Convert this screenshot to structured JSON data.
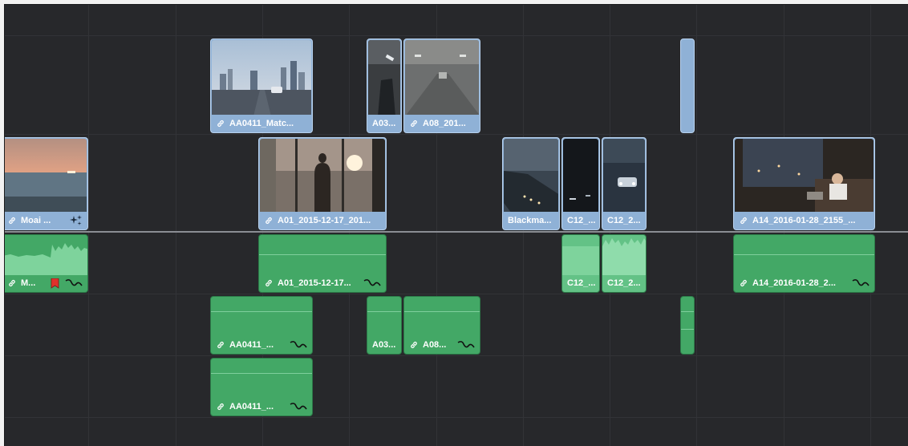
{
  "video_track_v2": {
    "clips": [
      {
        "name": "AA0411_Matc...",
        "linked": true
      },
      {
        "name": "A03...",
        "linked": false
      },
      {
        "name": "A08_201...",
        "linked": true
      }
    ]
  },
  "video_track_v1": {
    "clips": [
      {
        "name": "Moai ...",
        "linked": true
      },
      {
        "name": "A01_2015-12-17_201...",
        "linked": true
      },
      {
        "name": "Blackma...",
        "linked": false
      },
      {
        "name": "C12_...",
        "linked": false
      },
      {
        "name": "C12_2...",
        "linked": false
      },
      {
        "name": "A14_2016-01-28_2155_...",
        "linked": true
      }
    ]
  },
  "audio_track_a1": {
    "clips": [
      {
        "name": "M...",
        "linked": true,
        "marker_color": "#e0322b"
      },
      {
        "name": "A01_2015-12-17...",
        "linked": true
      },
      {
        "name": "C12_...",
        "linked": false
      },
      {
        "name": "C12_2...",
        "linked": false
      },
      {
        "name": "A14_2016-01-28_2...",
        "linked": true
      }
    ]
  },
  "audio_track_a2": {
    "clips": [
      {
        "name": "AA0411_...",
        "linked": true
      },
      {
        "name": "A03...",
        "linked": false
      },
      {
        "name": "A08...",
        "linked": true
      }
    ]
  },
  "audio_track_a3": {
    "clips": [
      {
        "name": "AA0411_...",
        "linked": true
      }
    ]
  },
  "colors": {
    "timeline_bg": "#27282b",
    "video_clip": "#8fb1d6",
    "audio_clip": "#43a866",
    "marker": "#e0322b"
  },
  "icons": [
    "link-icon",
    "fx-curve-icon",
    "sparkle-icon",
    "marker-flag-icon"
  ]
}
